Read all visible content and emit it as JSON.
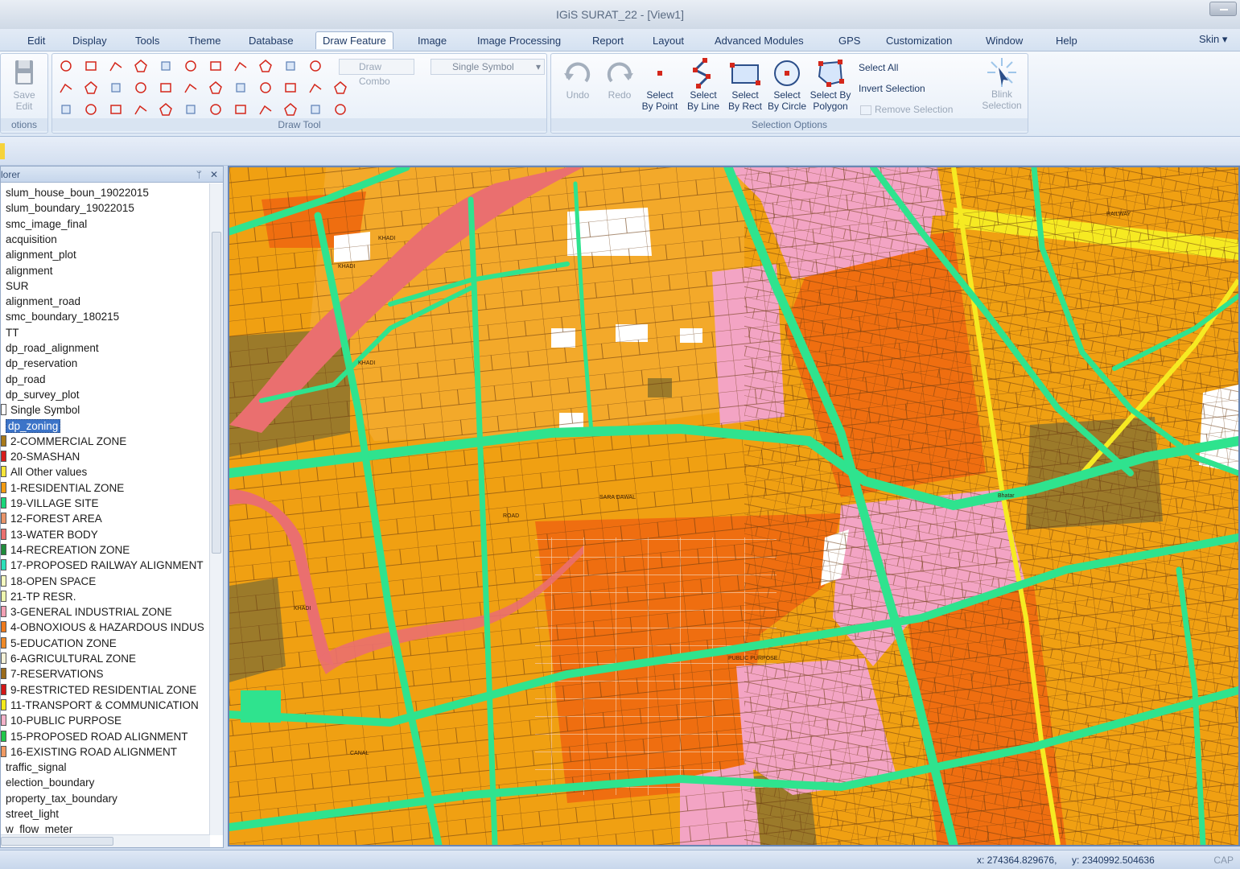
{
  "window": {
    "title": "IGiS SURAT_22 - [View1]"
  },
  "menu": {
    "items": [
      "Edit",
      "Display",
      "Tools",
      "Theme",
      "Database",
      "Draw Feature",
      "Image",
      "Image Processing",
      "Report",
      "Layout",
      "Advanced Modules",
      "GPS",
      "Customization",
      "Window",
      "Help"
    ],
    "active": "Draw Feature",
    "skin": "Skin"
  },
  "ribbon": {
    "save_edit": {
      "line1": "Save",
      "line2": "Edit"
    },
    "options_group": "otions",
    "draw_tool_group": "Draw Tool",
    "draw_combo": "Draw Combo",
    "single_symbol": "Single Symbol",
    "undo": "Undo",
    "redo": "Redo",
    "select_by_point": {
      "line1": "Select",
      "line2": "By Point"
    },
    "select_by_line": {
      "line1": "Select",
      "line2": "By Line"
    },
    "select_by_rect": {
      "line1": "Select",
      "line2": "By Rect"
    },
    "select_by_circle": {
      "line1": "Select",
      "line2": "By Circle"
    },
    "select_by_polygon": {
      "line1": "Select By",
      "line2": "Polygon"
    },
    "select_all": "Select All",
    "invert_selection": "Invert Selection",
    "remove_selection": "Remove Selection",
    "blink_selection": {
      "line1": "Blink",
      "line2": "Selection"
    },
    "selection_options_group": "Selection Options"
  },
  "explorer": {
    "title": "lorer",
    "pin": "ᛘ",
    "close": "✕",
    "layers": [
      {
        "name": "slum_house_boun_19022015",
        "type": "layer"
      },
      {
        "name": "slum_boundary_19022015",
        "type": "layer"
      },
      {
        "name": "smc_image_final",
        "type": "layer"
      },
      {
        "name": "acquisition",
        "type": "layer"
      },
      {
        "name": "alignment_plot",
        "type": "layer"
      },
      {
        "name": "alignment",
        "type": "layer"
      },
      {
        "name": "SUR",
        "type": "layer"
      },
      {
        "name": "alignment_road",
        "type": "layer"
      },
      {
        "name": "smc_boundary_180215",
        "type": "layer"
      },
      {
        "name": "TT",
        "type": "layer"
      },
      {
        "name": "dp_road_alignment",
        "type": "layer"
      },
      {
        "name": "dp_reservation",
        "type": "layer"
      },
      {
        "name": "dp_road",
        "type": "layer"
      },
      {
        "name": "dp_survey_plot",
        "type": "layer"
      },
      {
        "name": "Single Symbol",
        "type": "legend",
        "color": "#ffffff"
      },
      {
        "name": "dp_zoning",
        "type": "selected"
      },
      {
        "name": "2-COMMERCIAL ZONE",
        "type": "legend",
        "color": "#a87a1a"
      },
      {
        "name": "20-SMASHAN",
        "type": "legend",
        "color": "#d71c1c"
      },
      {
        "name": "All Other values",
        "type": "legend",
        "color": "#f6e53a"
      },
      {
        "name": "1-RESIDENTIAL ZONE",
        "type": "legend",
        "color": "#f39c12"
      },
      {
        "name": "19-VILLAGE SITE",
        "type": "legend",
        "color": "#19d67a"
      },
      {
        "name": "12-FOREST AREA",
        "type": "legend",
        "color": "#e8946a"
      },
      {
        "name": "13-WATER BODY",
        "type": "legend",
        "color": "#ea6f6f"
      },
      {
        "name": "14-RECREATION ZONE",
        "type": "legend",
        "color": "#1f8c3b"
      },
      {
        "name": "17-PROPOSED RAILWAY ALIGNMENT",
        "type": "legend",
        "color": "#2ce0b9"
      },
      {
        "name": "18-OPEN SPACE",
        "type": "legend",
        "color": "#f4f9c0"
      },
      {
        "name": "21-TP RESR.",
        "type": "legend",
        "color": "#eef6b0"
      },
      {
        "name": "3-GENERAL INDUSTRIAL ZONE",
        "type": "legend",
        "color": "#f2a0b4"
      },
      {
        "name": "4-OBNOXIOUS & HAZARDOUS INDUS",
        "type": "legend",
        "color": "#ef7a1c"
      },
      {
        "name": "5-EDUCATION ZONE",
        "type": "legend",
        "color": "#f08a28"
      },
      {
        "name": "6-AGRICULTURAL ZONE",
        "type": "legend",
        "color": "#f6f3d9"
      },
      {
        "name": "7-RESERVATIONS",
        "type": "legend",
        "color": "#9b6b1a"
      },
      {
        "name": "9-RESTRICTED RESIDENTIAL ZONE",
        "type": "legend",
        "color": "#d41818"
      },
      {
        "name": "11-TRANSPORT & COMMUNICATION",
        "type": "legend",
        "color": "#f4ea1c"
      },
      {
        "name": "10-PUBLIC PURPOSE",
        "type": "legend",
        "color": "#f3b2c9"
      },
      {
        "name": "15-PROPOSED ROAD ALIGNMENT",
        "type": "legend",
        "color": "#21c74a"
      },
      {
        "name": "16-EXISTING ROAD ALIGNMENT",
        "type": "legend",
        "color": "#f09a63"
      },
      {
        "name": "traffic_signal",
        "type": "layer"
      },
      {
        "name": "election_boundary",
        "type": "layer"
      },
      {
        "name": "property_tax_boundary",
        "type": "layer"
      },
      {
        "name": "street_light",
        "type": "layer"
      },
      {
        "name": "w_flow_meter",
        "type": "layer"
      }
    ]
  },
  "map": {
    "labels": [
      "KHADI",
      "KHADI",
      "KHADI",
      "KHADI",
      "RAILWAY",
      "CANAL",
      "ROAD",
      "PUBLIC PURPOSE",
      "SARA DAWAL",
      "Bhatar"
    ],
    "colors": {
      "residential": "#f0a012",
      "industrial": "#ef6e10",
      "road": "#2fe38e",
      "water": "#ea6f6f",
      "reservation": "#9b7a2a",
      "public": "#f3a4c4",
      "transport": "#f6ea22",
      "white": "#ffffff",
      "boundary": "#6b3a10"
    }
  },
  "status": {
    "x": "x: 274364.829676,",
    "y": "y: 2340992.504636",
    "cap": "CAP"
  }
}
